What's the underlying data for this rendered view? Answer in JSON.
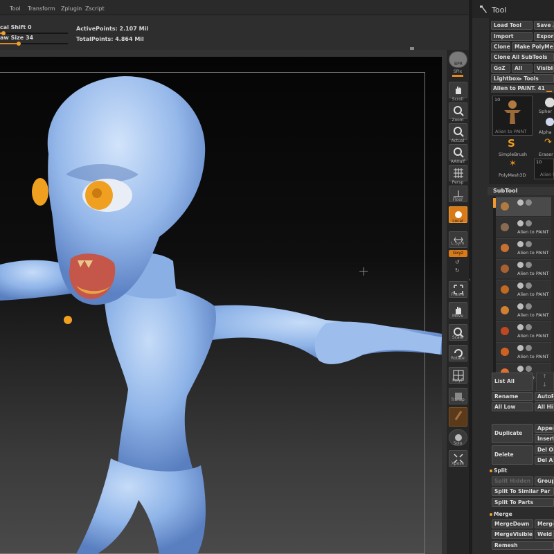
{
  "menubar": {
    "items": [
      "Tool",
      "Transform",
      "Zplugin",
      "Zscript"
    ]
  },
  "shelf": {
    "local_shift_label": "cal Shift 0",
    "local_shift_value": 0.05,
    "draw_size_label": "aw Size 34",
    "draw_size_value": 0.28,
    "active_points": "ActivePoints: 2.107 Mil",
    "total_points": "TotalPoints: 4.864 Mil"
  },
  "dock": {
    "bpr": "BPR",
    "spix": "SPix",
    "scroll": "Scroll",
    "zoom": "Zoom",
    "actual": "Actual",
    "aahalf": "AAHalf",
    "persp": "Persp",
    "floor": "Floor",
    "local": "Local",
    "lsym": "L.Sym",
    "xyz": "Gxyz",
    "frame": "Frame",
    "move": "Move",
    "scale": "Scale",
    "rotate": "Rotate",
    "polyf": "PolyF",
    "transp": "Transp",
    "solo": "Solo",
    "xpose": "Xpose"
  },
  "tool_panel": {
    "title": "Tool",
    "load_tool": "Load Tool",
    "save": "Save A",
    "import": "Import",
    "export": "Export",
    "clone": "Clone",
    "make_polymesh": "Make PolyMes",
    "clone_all": "Clone All SubTools",
    "goz": "GoZ",
    "all": "All",
    "visible": "Visible",
    "lightbox": "Lightbox▸ Tools",
    "current_tool": "Alien to PAINT. 41",
    "thumb_count_1": "10",
    "thumb_main_label": "Alien to PAINT",
    "thumb_sphere": "Spher",
    "thumb_alpha": "Alpha",
    "thumb_simplebrush": "SimpleBrush",
    "thumb_eraser": "Eraser",
    "thumb_polymesh": "PolyMesh3D",
    "thumb_count_2": "10",
    "thumb_alien_small": "Alien t",
    "subtool_title": "SubTool",
    "subtools": [
      {
        "name": ""
      },
      {
        "name": "Alien to PAINT"
      },
      {
        "name": "Alien to PAINT"
      },
      {
        "name": "Alien to PAINT"
      },
      {
        "name": "Alien to PAINT"
      },
      {
        "name": "Alien to PAINT"
      },
      {
        "name": "Alien to PAINT"
      },
      {
        "name": "Alien to PAINT"
      },
      {
        "name": "Alien to PAINT"
      }
    ],
    "list_all": "List All",
    "rename": "Rename",
    "autoreorder": "AutoRe",
    "all_low": "All Low",
    "all_high": "All Hig",
    "duplicate": "Duplicate",
    "append": "Append",
    "insert": "Insert",
    "delete": "Delete",
    "del_other": "Del Ot",
    "del_all": "Del Al",
    "split_title": "Split",
    "split_hidden": "Split Hidden",
    "groups": "Groups",
    "split_similar": "Split To Similar Par",
    "split_parts": "Split To Parts",
    "merge_title": "Merge",
    "merge_down": "MergeDown",
    "merge_similar": "MergeS",
    "merge_visible": "MergeVisible",
    "weld": "Weld",
    "remesh": "Remesh"
  },
  "colors": {
    "accent": "#e08a20",
    "model_skin": "#8fb4e8",
    "eyes": "#f0a020"
  }
}
